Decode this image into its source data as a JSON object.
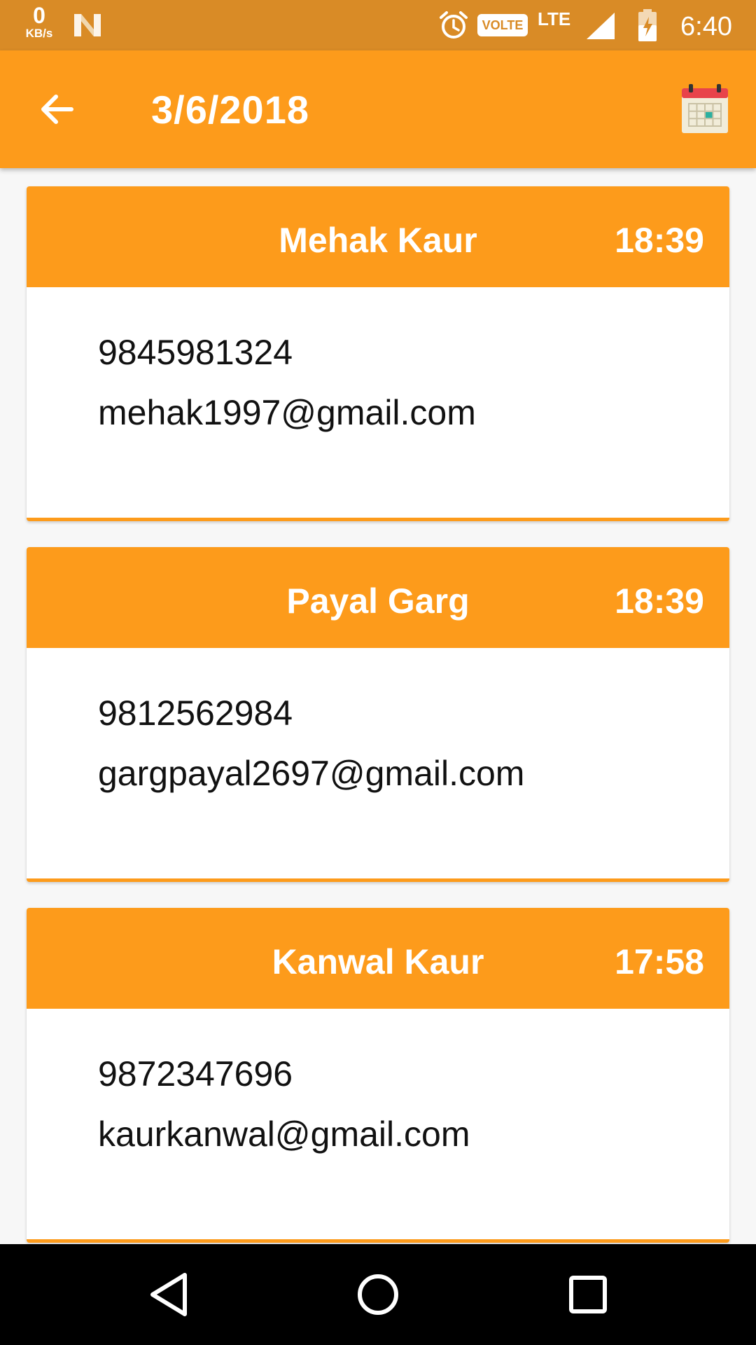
{
  "status_bar": {
    "speed_value": "0",
    "speed_unit": "KB/s",
    "network_badge": "VOLTE",
    "network_type": "LTE",
    "time": "6:40",
    "icons": [
      "n-notification-icon",
      "alarm-icon",
      "signal-icon",
      "battery-icon"
    ]
  },
  "app_bar": {
    "title": "3/6/2018",
    "back_icon": "arrow-left-icon",
    "action_icon": "calendar-icon"
  },
  "colors": {
    "status_bar": "#d98b26",
    "accent": "#fd9b1b",
    "card_bg": "#ffffff",
    "nav_bar": "#000000"
  },
  "entries": [
    {
      "name": "Mehak Kaur",
      "time": "18:39",
      "phone": "9845981324",
      "email": "mehak1997@gmail.com"
    },
    {
      "name": "Payal Garg",
      "time": "18:39",
      "phone": "9812562984",
      "email": "gargpayal2697@gmail.com"
    },
    {
      "name": "Kanwal Kaur",
      "time": "17:58",
      "phone": "9872347696",
      "email": "kaurkanwal@gmail.com"
    }
  ],
  "nav_bar": {
    "icons": [
      "nav-back-icon",
      "nav-home-icon",
      "nav-recents-icon"
    ]
  }
}
